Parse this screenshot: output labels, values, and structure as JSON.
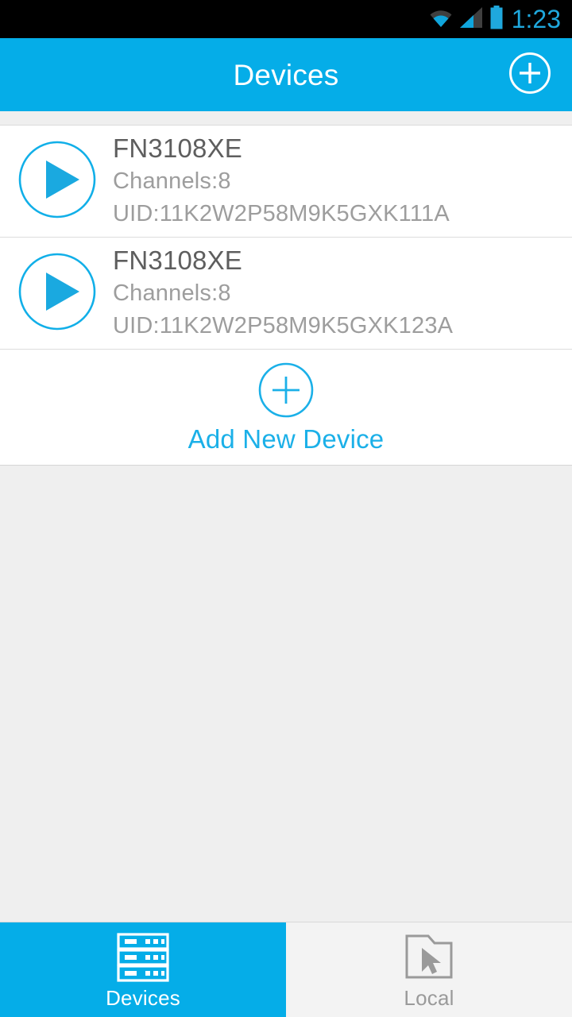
{
  "status_bar": {
    "time": "1:23",
    "icons": [
      "wifi-icon",
      "cellular-signal-icon",
      "battery-icon"
    ],
    "background": "#000000",
    "accent": "#1fa8dd"
  },
  "action_bar": {
    "title": "Devices",
    "add_button_icon": "plus-circle-icon",
    "background": "#05ade8",
    "text_color": "#ffffff"
  },
  "devices": [
    {
      "name": "FN3108XE",
      "channels": "Channels:8",
      "uid": "UID:11K2W2P58M9K5GXK111A",
      "action_icon": "play-circle-icon"
    },
    {
      "name": "FN3108XE",
      "channels": "Channels:8",
      "uid": "UID:11K2W2P58M9K5GXK123A",
      "action_icon": "play-circle-icon"
    }
  ],
  "add_new_device": {
    "label": "Add New Device",
    "icon": "plus-circle-icon",
    "color": "#1bb0e8"
  },
  "bottom_nav": {
    "tabs": [
      {
        "label": "Devices",
        "icon": "server-rack-icon",
        "active": true,
        "background": "#05ade8",
        "text_color": "#ffffff"
      },
      {
        "label": "Local",
        "icon": "folder-cursor-icon",
        "active": false,
        "background": "#f3f3f3",
        "text_color": "#9a9a9a"
      }
    ]
  },
  "theme": {
    "accent": "#05ade8",
    "surface": "#ffffff",
    "page_background": "#efefef",
    "divider": "#dddddd",
    "primary_text": "#5e5e5e",
    "secondary_text": "#9d9d9d"
  }
}
